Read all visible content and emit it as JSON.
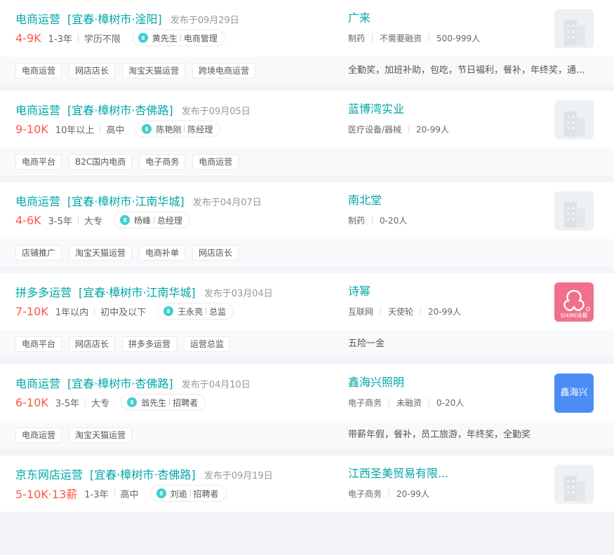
{
  "jobs": [
    {
      "title": "电商运营",
      "location": "[宜春·樟树市·淦阳]",
      "published": "发布于09月29日",
      "salary": "4-9K",
      "experience": "1-3年",
      "education": "学历不限",
      "recruiter_name": "黄先生",
      "recruiter_role": "电商管理",
      "company": "广来",
      "industry": "制药",
      "funding": "不需要融资",
      "size": "500-999人",
      "logo": "placeholder",
      "tags": [
        "电商运营",
        "网店店长",
        "淘宝天猫运营",
        "跨境电商运营"
      ],
      "welfare": "全勤奖，加班补助，包吃，节日福利，餐补，年终奖，通..."
    },
    {
      "title": "电商运营",
      "location": "[宜春·樟树市·杏佛路]",
      "published": "发布于09月05日",
      "salary": "9-10K",
      "experience": "10年以上",
      "education": "高中",
      "recruiter_name": "陈艳刚",
      "recruiter_role": "陈经理",
      "company": "蓝博湾实业",
      "industry": "医疗设备/器械",
      "funding": "",
      "size": "20-99人",
      "logo": "placeholder",
      "tags": [
        "电商平台",
        "B2C国内电商",
        "电子商务",
        "电商运营"
      ],
      "welfare": ""
    },
    {
      "title": "电商运营",
      "location": "[宜春·樟树市·江南华城]",
      "published": "发布于04月07日",
      "salary": "4-6K",
      "experience": "3-5年",
      "education": "大专",
      "recruiter_name": "杨峰",
      "recruiter_role": "总经理",
      "company": "南北堂",
      "industry": "制药",
      "funding": "",
      "size": "0-20人",
      "logo": "placeholder",
      "tags": [
        "店铺推广",
        "淘宝天猫运营",
        "电商补单",
        "网店店长"
      ],
      "welfare": ""
    },
    {
      "title": "拼多多运营",
      "location": "[宜春·樟树市·江南华城]",
      "published": "发布于03月04日",
      "salary": "7-10K",
      "experience": "1年以内",
      "education": "初中及以下",
      "recruiter_name": "王永亮",
      "recruiter_role": "总监",
      "company": "诗幂",
      "industry": "互联网",
      "funding": "天使轮",
      "size": "20-99人",
      "logo": "shimi",
      "logo_text": "SHIMI诗幂",
      "logo_color": "#f0708a",
      "tags": [
        "电商平台",
        "网店店长",
        "拼多多运营",
        "运营总监"
      ],
      "welfare": "五险一金"
    },
    {
      "title": "电商运营",
      "location": "[宜春·樟树市·杏佛路]",
      "published": "发布于04月10日",
      "salary": "6-10K",
      "experience": "3-5年",
      "education": "大专",
      "recruiter_name": "翁先生",
      "recruiter_role": "招聘者",
      "company": "鑫海兴照明",
      "industry": "电子商务",
      "funding": "未融资",
      "size": "0-20人",
      "logo": "text",
      "logo_text": "鑫海兴",
      "logo_color": "#4a8ef5",
      "tags": [
        "电商运营",
        "淘宝天猫运营"
      ],
      "welfare": "带薪年假，餐补，员工旅游，年终奖，全勤奖"
    },
    {
      "title": "京东网店运营",
      "location": "[宜春·樟树市·杏佛路]",
      "published": "发布于09月19日",
      "salary": "5-10K·13薪",
      "experience": "1-3年",
      "education": "高中",
      "recruiter_name": "刘逾",
      "recruiter_role": "招聘者",
      "company": "江西圣美贸易有限...",
      "industry": "电子商务",
      "funding": "",
      "size": "20-99人",
      "logo": "placeholder",
      "tags": [],
      "welfare": ""
    }
  ],
  "accent_color": "#00a6a7",
  "salary_color": "#fe574a"
}
